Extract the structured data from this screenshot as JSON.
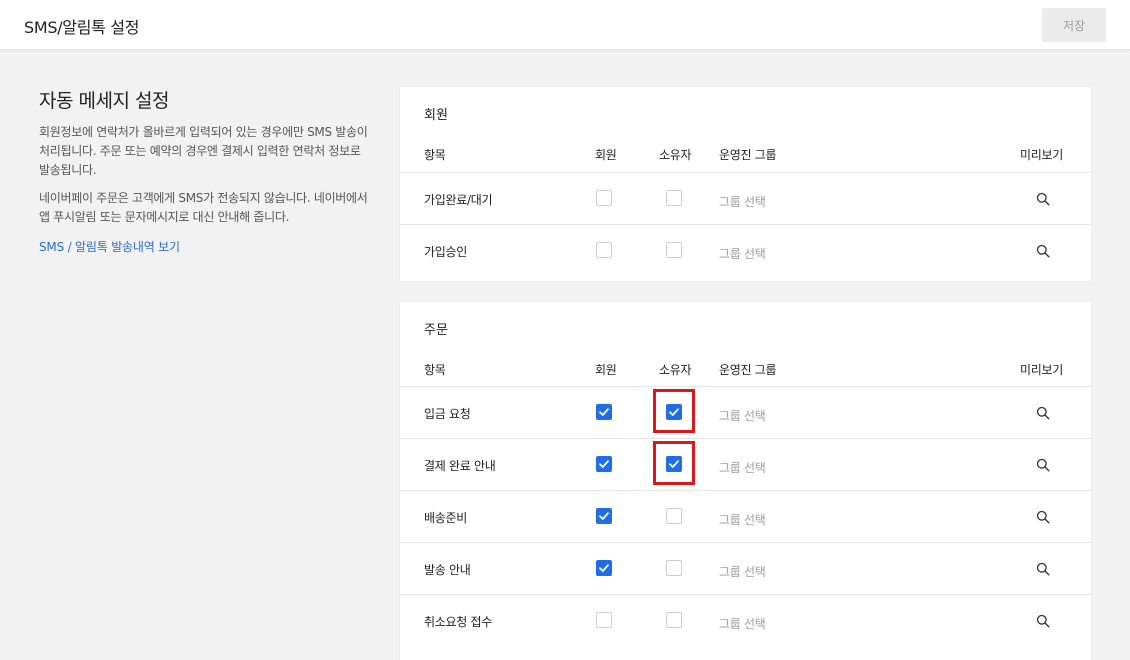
{
  "header": {
    "title": "SMS/알림톡 설정",
    "save_label": "저장"
  },
  "intro": {
    "title": "자동 메세지 설정",
    "para1": "회원정보에 연락처가 올바르게 입력되어 있는 경우에만 SMS 발송이 처리됩니다. 주문 또는 예약의 경우엔 결제시 입력한 연락처 정보로 발송됩니다.",
    "para2": "네이버페이 주문은 고객에게 SMS가 전송되지 않습니다. 네이버에서 앱 푸시알림 또는 문자메시지로 대신 안내해 줍니다.",
    "link": "SMS / 알림톡 발송내역 보기"
  },
  "columns": {
    "item": "항목",
    "member": "회원",
    "owner": "소유자",
    "group": "운영진 그룹",
    "preview": "미리보기"
  },
  "accent_color": "#1f6ee8",
  "highlight_color": "#e0161a",
  "member_section": {
    "title": "회원",
    "rows": [
      {
        "label": "가입완료/대기",
        "member": false,
        "owner": false,
        "group": "그룹 선택"
      },
      {
        "label": "가입승인",
        "member": false,
        "owner": false,
        "group": "그룹 선택"
      }
    ]
  },
  "order_section": {
    "title": "주문",
    "rows": [
      {
        "label": "입금 요청",
        "member": true,
        "owner": true,
        "group": "그룹 선택"
      },
      {
        "label": "결제 완료 안내",
        "member": true,
        "owner": true,
        "group": "그룹 선택"
      },
      {
        "label": "배송준비",
        "member": true,
        "owner": false,
        "group": "그룹 선택"
      },
      {
        "label": "발송 안내",
        "member": true,
        "owner": false,
        "group": "그룹 선택"
      },
      {
        "label": "취소요청 접수",
        "member": false,
        "owner": false,
        "group": "그룹 선택"
      }
    ]
  }
}
